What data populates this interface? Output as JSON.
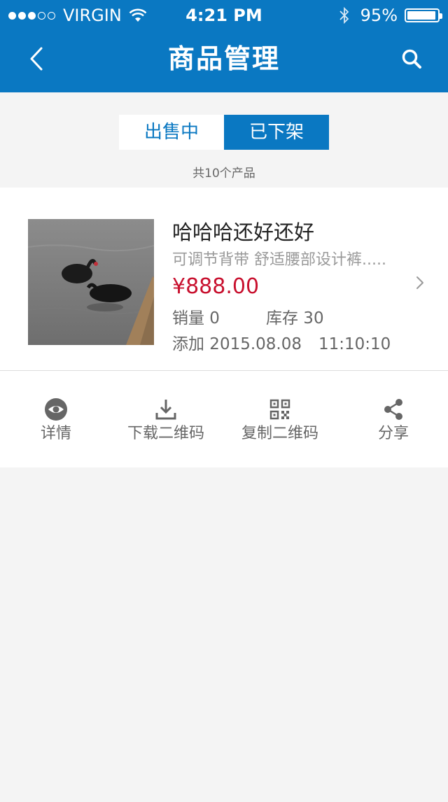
{
  "status_bar": {
    "carrier": "VIRGIN",
    "time": "4:21 PM",
    "battery_text": "95%",
    "battery_level": 0.95,
    "signal_bars": 3,
    "signal_total": 5
  },
  "nav": {
    "title": "商品管理",
    "back_icon": "chevron-left-icon",
    "search_icon": "search-icon"
  },
  "segment": {
    "tabs": [
      {
        "label": "出售中",
        "active": false
      },
      {
        "label": "已下架",
        "active": true
      }
    ]
  },
  "summary": {
    "count_text": "共10个产品"
  },
  "product": {
    "name": "哈哈哈还好还好",
    "description": "可调节背带 舒适腰部设计裤.....",
    "price": "¥888.00",
    "sales": "销量 0",
    "stock": "库存 30",
    "added_date": "添加 2015.08.08",
    "added_time": "11:10:10"
  },
  "actions": [
    {
      "label": "详情",
      "icon": "eye-icon"
    },
    {
      "label": "下载二维码",
      "icon": "download-icon"
    },
    {
      "label": "复制二维码",
      "icon": "qr-code-icon"
    },
    {
      "label": "分享",
      "icon": "share-icon"
    }
  ],
  "colors": {
    "brand_blue": "#0a78c2",
    "price_red": "#c8102e",
    "background": "#f4f4f4"
  }
}
